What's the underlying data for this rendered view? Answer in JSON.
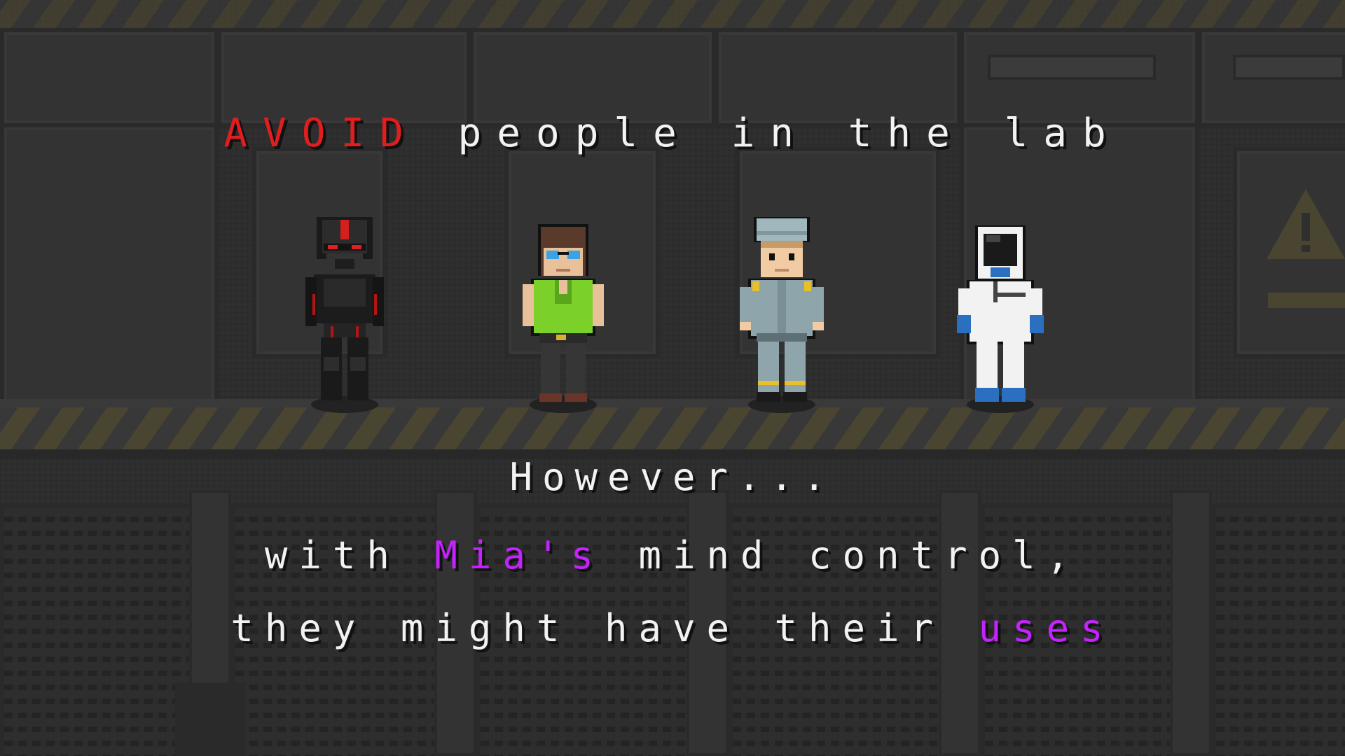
{
  "intro": {
    "line1": {
      "highlight": "AVOID",
      "rest": " people in the lab"
    },
    "line2": "However...",
    "line3": {
      "before": "with ",
      "highlight": "Mia's",
      "after": " mind control,"
    },
    "line4": {
      "before": "they might have their ",
      "highlight": "uses"
    }
  },
  "colors": {
    "danger": "#e01e1e",
    "mind_control": "#c422ff",
    "text": "#f2f2f2",
    "hazard_stripe": "#4a4531"
  },
  "characters": [
    {
      "role": "armored-guard",
      "icon": "guard-sprite"
    },
    {
      "role": "green-shirt-intern",
      "icon": "intern-sprite"
    },
    {
      "role": "uniformed-worker",
      "icon": "worker-sprite"
    },
    {
      "role": "hazmat-scientist",
      "icon": "scientist-sprite"
    }
  ]
}
